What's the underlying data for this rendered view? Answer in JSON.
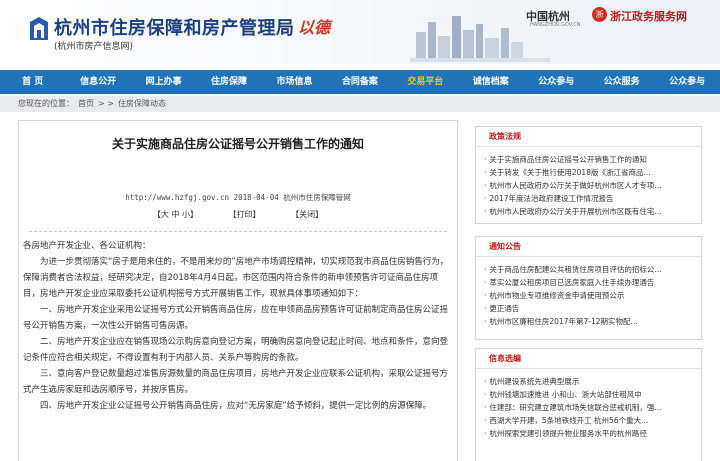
{
  "header": {
    "title": "杭州市住房保障和房产管理局",
    "subtitle": "(杭州市房产信息网)",
    "seal": "以德",
    "hangzhou_link": "中国杭州",
    "hangzhou_sub": "HANGZHOU.GOV.CN",
    "zhejiang_badge": "浙",
    "zhejiang_link": "浙江政务服务网"
  },
  "nav": [
    {
      "label": "首 页",
      "active": false
    },
    {
      "label": "信息公开",
      "active": false
    },
    {
      "label": "网上办事",
      "active": false
    },
    {
      "label": "住房保障",
      "active": false
    },
    {
      "label": "市场信息",
      "active": false
    },
    {
      "label": "合同备案",
      "active": false
    },
    {
      "label": "交易平台",
      "active": true
    },
    {
      "label": "诚信档案",
      "active": false
    },
    {
      "label": "公众参与",
      "active": false
    },
    {
      "label": "公众服务",
      "active": false
    },
    {
      "label": "公众参与",
      "active": false
    }
  ],
  "breadcrumb": {
    "prefix": "您现在的位置：",
    "home": "首页",
    "sep": "> >",
    "current": "住房保障动态"
  },
  "article": {
    "title": "关于实施商品住房公证摇号公开销售工作的通知",
    "meta": "http://www.hzfgj.gov.cn  2018-04-04  杭州市住房保障管网",
    "tools": [
      "【大 中 小】",
      "【打印】",
      "【关闭】"
    ],
    "paragraphs": [
      {
        "text": "各房地产开发企业、各公证机构：",
        "indent": false
      },
      {
        "text": "为进一步贯彻落实“房子是用来住的，不是用来炒的”房地产市场调控精神，切实规范我市商品住房销售行为，保障消费者合法权益，经研究决定，自2018年4月4日起，市区范围内符合条件的新申领预售许可证商品住房项目，房地产开发企业应采取委托公证机构摇号方式开展销售工作，现就具体事项通知如下：",
        "indent": true
      },
      {
        "text": "一、房地产开发企业采用公证摇号方式公开销售商品住房，应在申领商品房预售许可证前制定商品住房公证摇号公开销售方案，一次性公开销售可售房源。",
        "indent": true
      },
      {
        "text": "二、房地产开发企业应在销售现场公示购房意向登记方案，明确购房意向登记起止时间、地点和条件，意向登记条件应符合相关规定，不得设置有利于内部人员、关系户等购房的条款。",
        "indent": true
      },
      {
        "text": "三、意向客户登记数量超过准售房源数量的商品住房项目，房地产开发企业应联系公证机构，采取公证摇号方式产生选房家庭和选房顺序号，并按序售房。",
        "indent": true
      },
      {
        "text": "四、房地产开发企业公证摇号公开销售商品住房，应对“无房家庭”给予倾斜，提供一定比例的房源保障。",
        "indent": true
      }
    ]
  },
  "sidebar": {
    "policy": {
      "title": "政策法规",
      "items": [
        "关于实施商品住房公证摇号公开销售工作的通知",
        "关于转发《关于推行使用2018版《浙江省商品...",
        "杭州市人民政府办公厅关于做好杭州市区人才专项...",
        "2017年度法治政府建设工作情况报告",
        "杭州市人民政府办公厅关于开展杭州市区既有住宅..."
      ]
    },
    "notice": {
      "title": "通知公告",
      "items": [
        "关于商品住房配建公共租赁住房项目评估的招标公...",
        "萃实公厦公租房项目已选房家庭入住手续办理通告",
        "杭州市物业专项维修资金申请使用预公示",
        "更正通告",
        "杭州市区廉租住房2017年第7-12期实物配..."
      ]
    },
    "news": {
      "title": "信息选编",
      "items": [
        "杭州建设系统先进典型展示",
        "杭州钱塘加速推进 小和山、浙大站部住租风中",
        "住建部：研究建立建筑市场失信联合惩戒机制，强...",
        "西湖大学开建，5条地铁线开工 杭州56个重大...",
        "杭州探索党建引领提升物业服务水平的杭州路径"
      ]
    }
  }
}
